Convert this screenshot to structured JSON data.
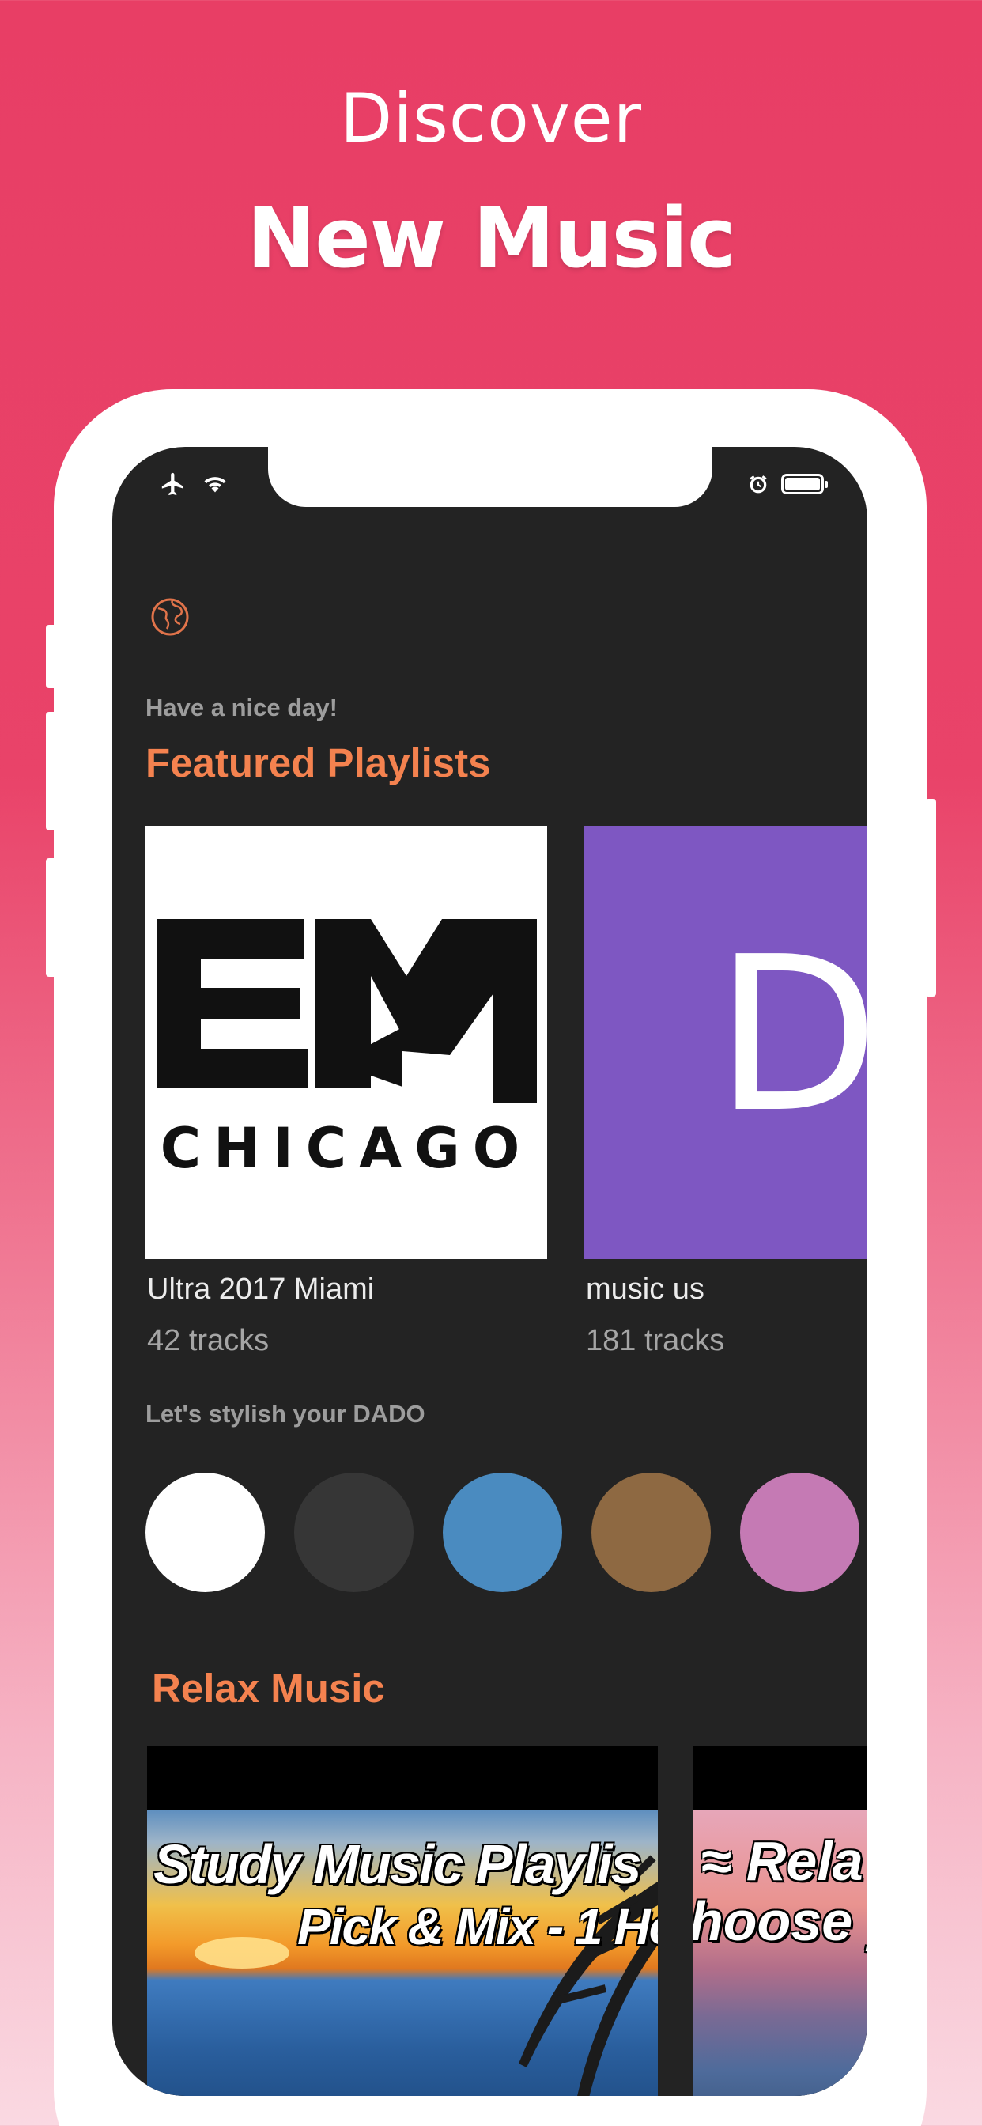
{
  "promo": {
    "line1": "Discover",
    "line2": "New Music"
  },
  "status_bar": {
    "left_icons": [
      "airplane-icon",
      "wifi-icon"
    ],
    "right_icons": [
      "alarm-icon",
      "battery-icon"
    ]
  },
  "header": {
    "icon": "globe-icon",
    "greeting": "Have a nice day!"
  },
  "featured": {
    "title": "Featured Playlists",
    "playlists": [
      {
        "name": "Ultra 2017 Miami",
        "tracks": "42 tracks",
        "logo_text": "CHICAGO"
      },
      {
        "name": "music us",
        "tracks": "181 tracks",
        "letter": "D",
        "color": "#7e57c2"
      }
    ]
  },
  "theme": {
    "label": "Let's stylish your DADO",
    "colors": [
      "#ffffff",
      "#363636",
      "#4a8bc0",
      "#8e6942",
      "#c57ab4"
    ]
  },
  "relax": {
    "title": "Relax Music",
    "cards": [
      {
        "line1": "Study Music Playlis",
        "line2": "Pick & Mix - 1 Ho"
      },
      {
        "line1": "≈ Rela",
        "line2": "hoose y"
      }
    ]
  },
  "colors": {
    "accent": "#f4824f",
    "background": "#e83e65",
    "screen": "#232323"
  }
}
